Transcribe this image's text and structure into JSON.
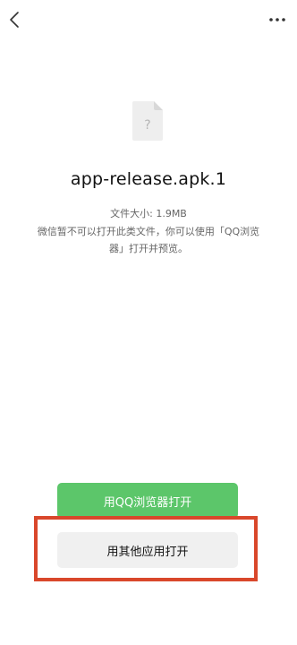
{
  "header": {
    "back_icon": "chevron-left-icon",
    "more_icon": "more-horizontal-icon"
  },
  "file": {
    "icon": "unknown-file-icon",
    "icon_glyph": "?",
    "name": "app-release.apk.1",
    "size_text": "文件大小: 1.9MB",
    "notice_text": "微信暂不可以打开此类文件，你可以使用「QQ浏览器」打开并预览。"
  },
  "actions": {
    "open_qq_label": "用QQ浏览器打开",
    "open_other_label": "用其他应用打开"
  },
  "colors": {
    "primary_green": "#5cc66a",
    "highlight_red": "#d9472b",
    "secondary_button": "#f0f0f0"
  }
}
